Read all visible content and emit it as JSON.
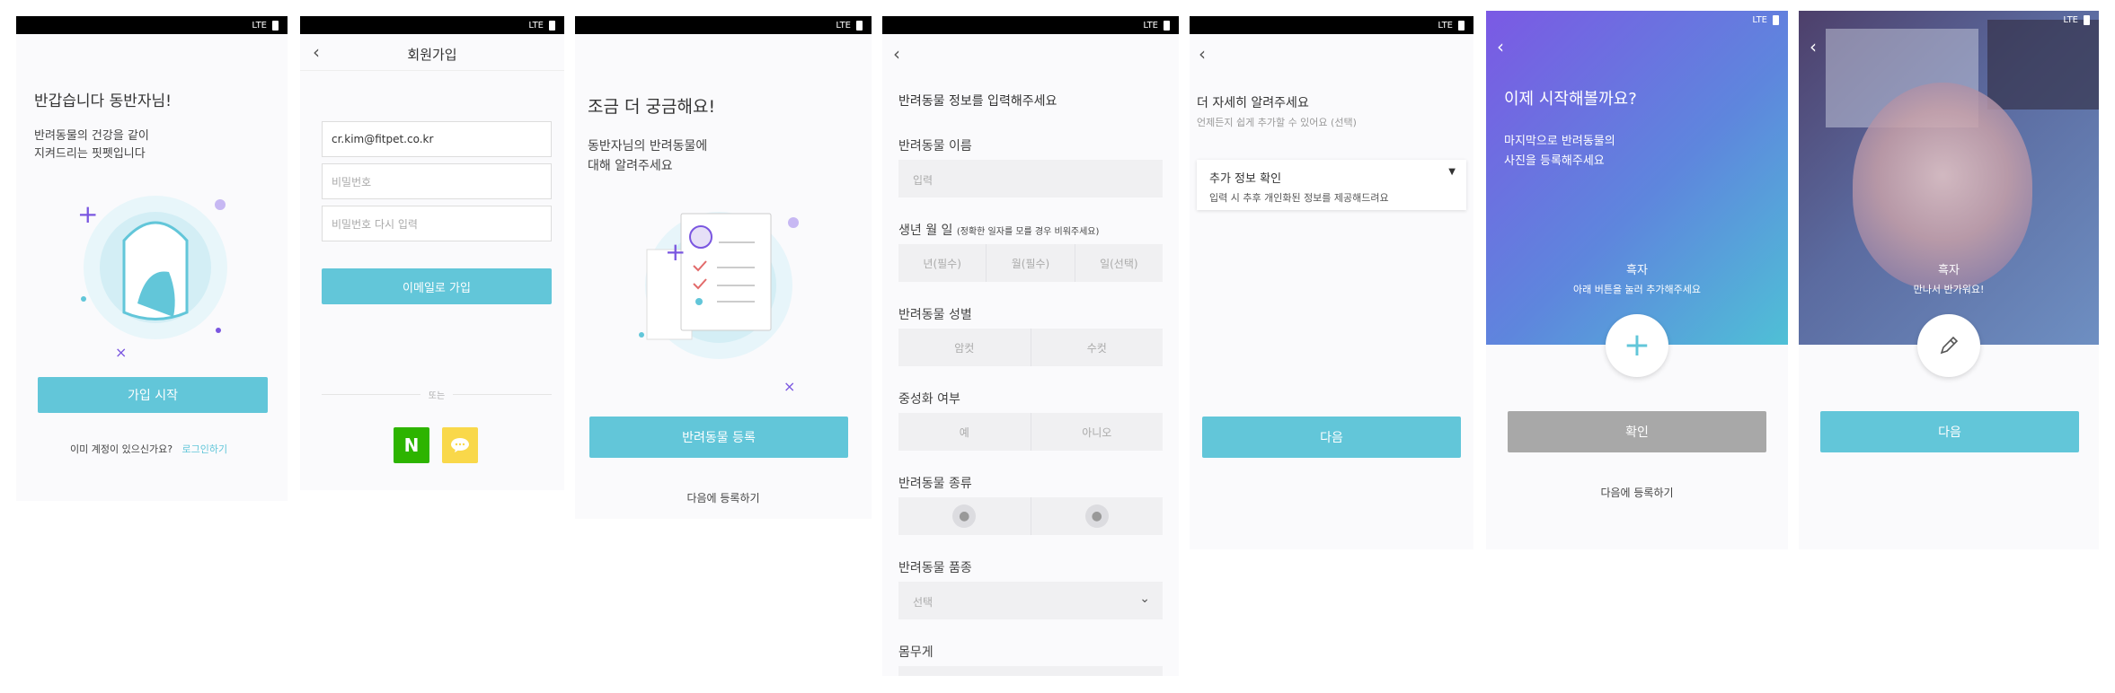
{
  "status_bar": {
    "network": "LTE"
  },
  "s1": {
    "title": "반갑습니다 동반자님!",
    "subtitle_line1": "반려동물의 건강을 같이",
    "subtitle_line2": "지켜드리는 핏펫입니다",
    "signup_button": "가입 시작",
    "has_account": "이미 계정이 있으신가요?",
    "login_link": "로그인하기"
  },
  "s2": {
    "header_title": "회원가입",
    "email_value": "cr.kim@fitpet.co.kr",
    "password_placeholder": "비밀번호",
    "password_confirm_placeholder": "비밀번호 다시 입력",
    "email_signup_button": "이메일로 가입",
    "or_label": "또는",
    "naver_label": "N"
  },
  "s3": {
    "title": "조금 더 궁금해요!",
    "subtitle_line1": "동반자님의 반려동물에",
    "subtitle_line2": "대해 알려주세요",
    "register_button": "반려동물 등록",
    "later_link": "다음에 등록하기"
  },
  "s4": {
    "heading": "반려동물 정보를 입력해주세요",
    "name_label": "반려동물 이름",
    "name_placeholder": "입력",
    "birth_label": "생년 월 일",
    "birth_hint": "(정확한 일자를 모를 경우 비워주세요)",
    "birth_year": "년(필수)",
    "birth_month": "월(필수)",
    "birth_day": "일(선택)",
    "gender_label": "반려동물 성별",
    "gender_female": "암컷",
    "gender_male": "수컷",
    "neuter_label": "중성화 여부",
    "neuter_yes": "예",
    "neuter_no": "아니오",
    "type_label": "반려동물 종류",
    "breed_label": "반려동물 품종",
    "breed_placeholder": "선택",
    "weight_label": "몸무게"
  },
  "s5": {
    "heading": "더 자세히 알려주세요",
    "subheading": "언제든지 쉽게 추가할 수 있어요 (선택)",
    "extra_title": "추가 정보 확인",
    "extra_desc": "입력 시 추후 개인화된 정보를 제공해드려요",
    "next_button": "다음"
  },
  "s6": {
    "heading": "이제 시작해볼까요?",
    "subtitle_line1": "마지막으로 반려동물의",
    "subtitle_line2": "사진을 등록해주세요",
    "pet_name": "흑자",
    "pet_hint": "아래 버튼을 눌러 추가해주세요",
    "confirm_button": "확인",
    "later_link": "다음에 등록하기"
  },
  "s7": {
    "pet_name": "흑자",
    "greeting": "만나서 반가워요!",
    "next_button": "다음"
  },
  "colors": {
    "accent": "#62c6d9",
    "purple": "#7a56e0",
    "disabled": "#a8a8a8"
  }
}
